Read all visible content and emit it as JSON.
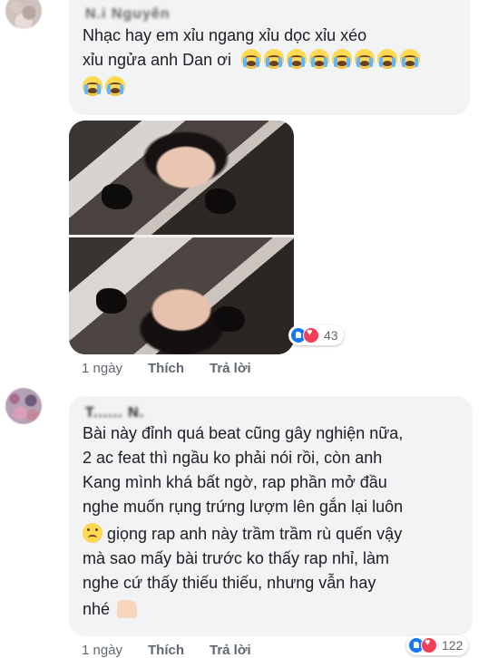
{
  "comments": [
    {
      "author": "N.i Nguyên",
      "lines": [
        "Nhạc hay  em xỉu ngang xỉu dọc xỉu xéo",
        "xỉu ngửa anh Dan ơi"
      ],
      "emoji_row_count": 8,
      "emoji_row2_count": 2,
      "emoji": "crying-face",
      "reactions": {
        "count": "43",
        "types": [
          "like-icon",
          "love-icon"
        ]
      },
      "actions": {
        "time": "1 ngày",
        "like": "Thích",
        "reply": "Trả lời"
      }
    },
    {
      "author": "T...... N.",
      "lines": [
        "Bài này đỉnh quá beat cũng gây nghiện nữa,",
        "2 ac feat thì ngầu ko phải nói rồi, còn anh",
        "Kang mình khá bất ngờ, rap phần mở đầu",
        "nghe muốn rụng trứng lượm lên gắn lại luôn",
        " giọng rap anh này trầm trầm rù quến vậy",
        "mà sao mấy bài trước ko thấy rap nhỉ, làm",
        "nghe cứ thấy thiếu thiếu, nhưng vẫn hay",
        "nhé"
      ],
      "reactions": {
        "count": "122",
        "types": [
          "like-icon",
          "love-icon"
        ]
      },
      "actions": {
        "time": "1 ngày",
        "like": "Thích",
        "reply": "Trả lời"
      }
    }
  ],
  "colors": {
    "bubble": "#f2f3f5",
    "like": "#1877f2",
    "love": "#f33e58",
    "meta": "#606770"
  }
}
